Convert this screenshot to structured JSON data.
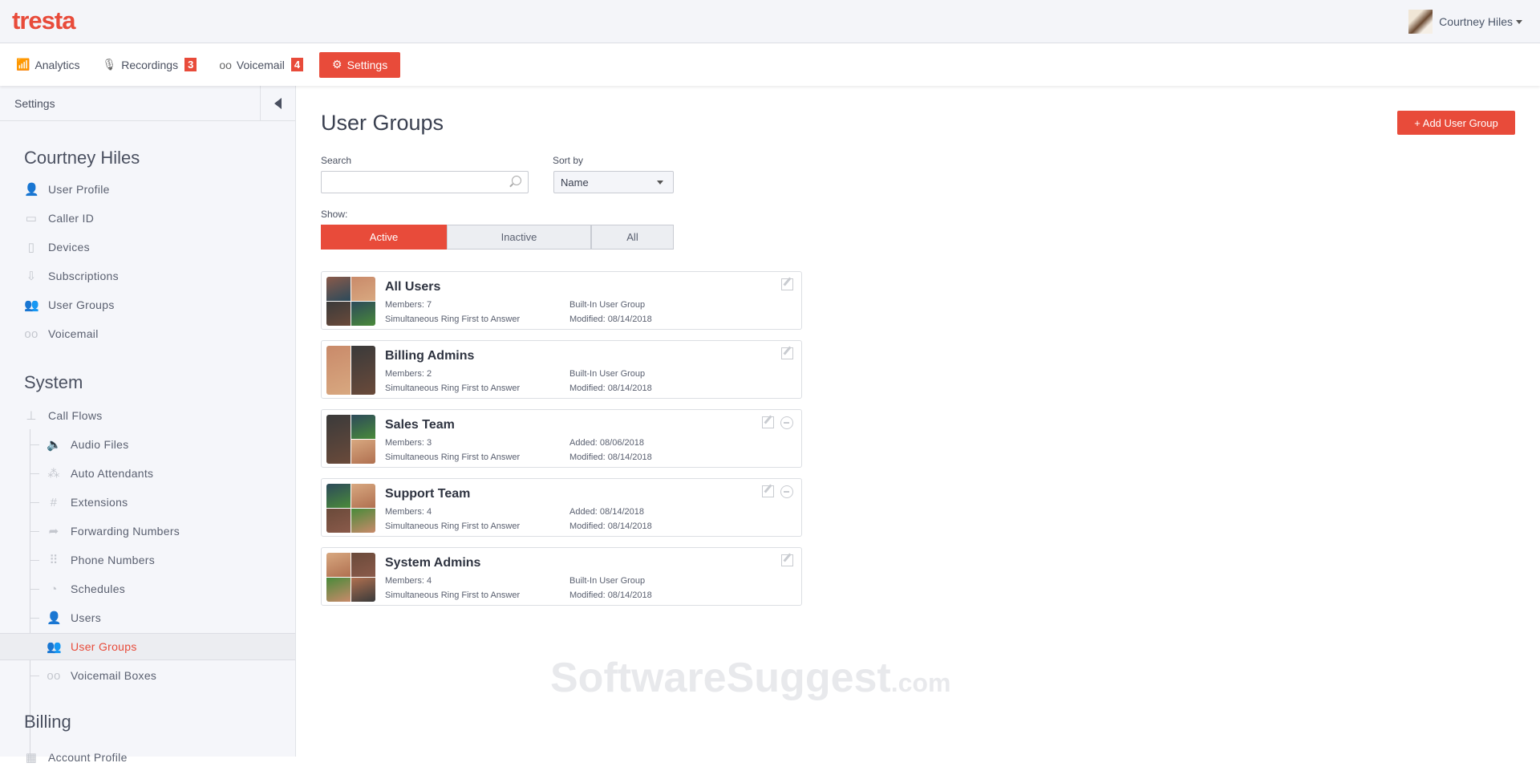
{
  "app": {
    "logo": "tresta",
    "user_name": "Courtney Hiles"
  },
  "nav": [
    {
      "label": "Analytics",
      "icon": "analytics-icon"
    },
    {
      "label": "Recordings",
      "icon": "microphone-icon",
      "badge": "3"
    },
    {
      "label": "Voicemail",
      "icon": "voicemail-icon",
      "badge": "4"
    },
    {
      "label": "Settings",
      "icon": "gear-icon",
      "active": true
    }
  ],
  "sidebar": {
    "header": "Settings",
    "sections": {
      "user": "Courtney Hiles",
      "system": "System",
      "billing": "Billing"
    },
    "user_items": [
      "User Profile",
      "Caller ID",
      "Devices",
      "Subscriptions",
      "User Groups",
      "Voicemail"
    ],
    "call_flows": "Call Flows",
    "system_items": [
      "Audio Files",
      "Auto Attendants",
      "Extensions",
      "Forwarding Numbers",
      "Phone Numbers",
      "Schedules",
      "Users",
      "User Groups",
      "Voicemail Boxes"
    ],
    "billing_items": [
      "Account Profile"
    ]
  },
  "page": {
    "title": "User Groups",
    "add_button": "+ Add User Group",
    "search_label": "Search",
    "search_value": "",
    "sort_label": "Sort by",
    "sort_value": "Name",
    "show_label": "Show:",
    "show_options": [
      "Active",
      "Inactive",
      "All"
    ]
  },
  "groups": [
    {
      "name": "All Users",
      "members": "Members: 7",
      "ring": "Simultaneous Ring First to Answer",
      "info": "Built-In User Group",
      "modified": "Modified: 08/14/2018",
      "removable": false
    },
    {
      "name": "Billing Admins",
      "members": "Members: 2",
      "ring": "Simultaneous Ring First to Answer",
      "info": "Built-In User Group",
      "modified": "Modified: 08/14/2018",
      "removable": false
    },
    {
      "name": "Sales Team",
      "members": "Members: 3",
      "ring": "Simultaneous Ring First to Answer",
      "info": "Added: 08/06/2018",
      "modified": "Modified: 08/14/2018",
      "removable": true
    },
    {
      "name": "Support Team",
      "members": "Members: 4",
      "ring": "Simultaneous Ring First to Answer",
      "info": "Added: 08/14/2018",
      "modified": "Modified: 08/14/2018",
      "removable": true
    },
    {
      "name": "System Admins",
      "members": "Members: 4",
      "ring": "Simultaneous Ring First to Answer",
      "info": "Built-In User Group",
      "modified": "Modified: 08/14/2018",
      "removable": false
    }
  ],
  "watermark": {
    "main": "SoftwareSuggest",
    "suffix": ".com"
  },
  "colors": {
    "accent": "#e84b3a"
  }
}
